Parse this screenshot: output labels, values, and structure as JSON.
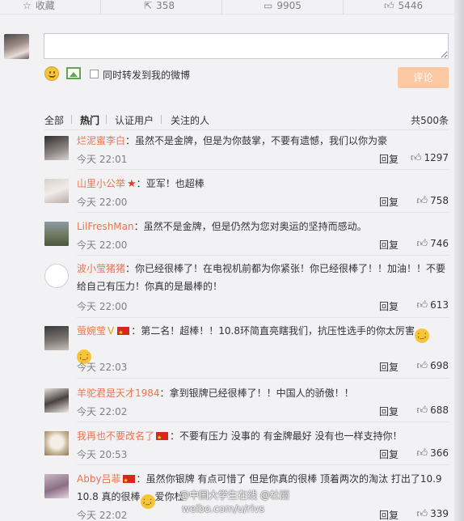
{
  "toolbar": {
    "favorite": {
      "label": "收藏",
      "icon": "star-icon"
    },
    "repost": {
      "count": "358",
      "icon": "repost-icon"
    },
    "comment": {
      "count": "9905",
      "icon": "comment-icon"
    },
    "like": {
      "count": "5446",
      "icon": "thumbs-up-icon"
    }
  },
  "composer": {
    "input_value": "",
    "repost_label": "同时转发到我的微博",
    "submit_label": "评论"
  },
  "filters": {
    "items": [
      "全部",
      "热门",
      "认证用户",
      "关注的人"
    ],
    "active": "热门",
    "total": "共500条"
  },
  "comments": [
    {
      "user": "烂泥蜜李白",
      "text": "虽然不是金牌，但是为你鼓掌，不要有遗憾，我们以你为豪",
      "time": "今天 22:01",
      "reply": "回复",
      "likes": "1297"
    },
    {
      "user": "山里小公举",
      "text": "亚军！也超棒",
      "time": "今天 22:00",
      "reply": "回复",
      "likes": "758"
    },
    {
      "user": "LilFreshMan",
      "text": "虽然不是金牌，但是仍然为您对奥运的坚持而感动。",
      "time": "今天 22:00",
      "reply": "回复",
      "likes": "746"
    },
    {
      "user": "波小莹猪猪",
      "text": "你已经很棒了！在电视机前都为你紧张！你已经很棒了！！加油！！不要给自己有压力！你真的是最棒的！",
      "time": "今天 22:00",
      "reply": "回复",
      "likes": "613"
    },
    {
      "user": "萤婉莹",
      "text": "第二名！超棒！！10.8环简直亮瞎我们，抗压性选手的你太厉害",
      "time": "今天 22:03",
      "reply": "回复",
      "likes": "698"
    },
    {
      "user": "羊驼君是天才1984",
      "text": "拿到银牌已经很棒了！！中国人的骄傲！！",
      "time": "今天 22:02",
      "reply": "回复",
      "likes": "688"
    },
    {
      "user": "我再也不要改名了",
      "text": "不要有压力 没事的 有金牌最好 没有也一样支持你！",
      "time": "今天 20:53",
      "reply": "回复",
      "likes": "366"
    },
    {
      "user": "Abby吕菲",
      "text": "虽然你银牌 有点可惜了 但是你真的很棒  顶着两次的淘汰 打出了10.9 10.8 真的很棒",
      "text_tail": "爱你杜",
      "time": "今天 22:02",
      "reply": "回复",
      "likes": "339"
    }
  ],
  "watermark": {
    "line1": "@中国大学生在线 @杜丽",
    "line2": "weibo.com/u/rivs"
  },
  "colors": {
    "username": "#eb7350",
    "submit_disabled": "#fcc9a3",
    "background": "#f2f2f5"
  }
}
